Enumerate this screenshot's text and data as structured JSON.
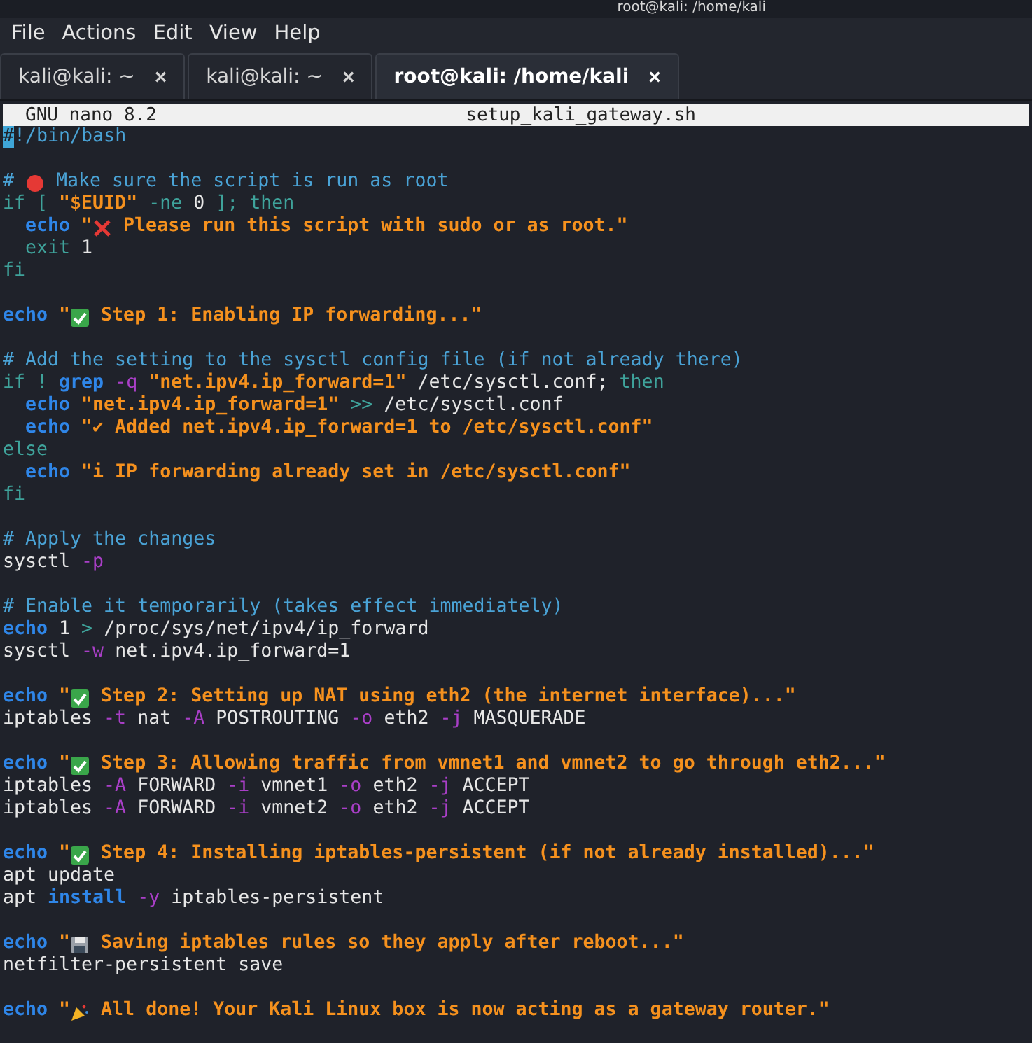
{
  "window": {
    "title": "root@kali: /home/kali"
  },
  "menu": [
    "File",
    "Actions",
    "Edit",
    "View",
    "Help"
  ],
  "tabs": [
    {
      "label": "kali@kali: ~",
      "close": "×",
      "selected": false
    },
    {
      "label": "kali@kali: ~",
      "close": "×",
      "selected": false
    },
    {
      "label": "root@kali: /home/kali",
      "close": "×",
      "selected": true
    }
  ],
  "nano_header": {
    "version": "GNU nano 8.2",
    "filename": "setup_kali_gateway.sh"
  },
  "lines": [
    {
      "tokens": [
        {
          "kind": "cursor",
          "t": "#"
        },
        {
          "kind": "comment",
          "t": "!/bin/bash"
        }
      ]
    },
    {
      "blank_before": true,
      "tokens": [
        {
          "kind": "comment",
          "t": "#"
        },
        {
          "kind": "dot"
        },
        {
          "kind": "comment",
          "t": "Make sure the script is run as root"
        }
      ]
    },
    {
      "tokens": [
        {
          "kind": "keyword",
          "t": "if ["
        },
        {
          "kind": "string",
          "t": "\"$EUID\""
        },
        {
          "kind": "keyword",
          "t": "-ne"
        },
        {
          "kind": "plain",
          "t": "0"
        },
        {
          "kind": "keyword",
          "t": "]; then"
        }
      ]
    },
    {
      "indented": true,
      "tokens": [
        {
          "kind": "builtin",
          "t": "echo"
        },
        {
          "kind": "string",
          "t": "\""
        },
        {
          "kind": "cross"
        },
        {
          "kind": "string",
          "t": "Please run this script with sudo or as root.\""
        }
      ]
    },
    {
      "indented": true,
      "tokens": [
        {
          "kind": "keyword",
          "t": "exit"
        },
        {
          "kind": "plain",
          "t": "1"
        }
      ]
    },
    {
      "tokens": [
        {
          "kind": "keyword",
          "t": "fi"
        }
      ]
    },
    {
      "blank_before": true,
      "tokens": [
        {
          "kind": "builtin",
          "t": "echo"
        },
        {
          "kind": "string",
          "t": "\""
        },
        {
          "kind": "check"
        },
        {
          "kind": "string",
          "t": "Step 1: Enabling IP forwarding...\""
        }
      ]
    },
    {
      "blank_before": true,
      "tokens": [
        {
          "kind": "comment",
          "t": "# Add the setting to the sysctl config file (if not already there)"
        }
      ]
    },
    {
      "tokens": [
        {
          "kind": "keyword",
          "t": "if !"
        },
        {
          "kind": "builtin",
          "t": "grep"
        },
        {
          "kind": "option",
          "t": "-q"
        },
        {
          "kind": "string",
          "t": "\"net.ipv4.ip_forward=1\""
        },
        {
          "kind": "plain",
          "t": "/etc/sysctl.conf;"
        },
        {
          "kind": "keyword",
          "t": "then"
        }
      ]
    },
    {
      "indented": true,
      "tokens": [
        {
          "kind": "builtin",
          "t": "echo"
        },
        {
          "kind": "string",
          "t": "\"net.ipv4.ip_forward=1\""
        },
        {
          "kind": "keyword",
          "t": ">>"
        },
        {
          "kind": "plain",
          "t": "/etc/sysctl.conf"
        }
      ]
    },
    {
      "indented": true,
      "tokens": [
        {
          "kind": "builtin",
          "t": "echo"
        },
        {
          "kind": "string",
          "t": "\"✔ Added net.ipv4.ip_forward=1 to /etc/sysctl.conf\""
        }
      ]
    },
    {
      "tokens": [
        {
          "kind": "keyword",
          "t": "else"
        }
      ]
    },
    {
      "indented": true,
      "tokens": [
        {
          "kind": "builtin",
          "t": "echo"
        },
        {
          "kind": "string",
          "t": "\"i IP forwarding already set in /etc/sysctl.conf\""
        }
      ]
    },
    {
      "tokens": [
        {
          "kind": "keyword",
          "t": "fi"
        }
      ]
    },
    {
      "blank_before": true,
      "tokens": [
        {
          "kind": "comment",
          "t": "# Apply the changes"
        }
      ]
    },
    {
      "tokens": [
        {
          "kind": "plain",
          "t": "sysctl"
        },
        {
          "kind": "option",
          "t": "-p"
        }
      ]
    },
    {
      "blank_before": true,
      "tokens": [
        {
          "kind": "comment",
          "t": "# Enable it temporarily (takes effect immediately)"
        }
      ]
    },
    {
      "tokens": [
        {
          "kind": "builtin",
          "t": "echo"
        },
        {
          "kind": "plain",
          "t": "1"
        },
        {
          "kind": "keyword",
          "t": ">"
        },
        {
          "kind": "plain",
          "t": "/proc/sys/net/ipv4/ip_forward"
        }
      ]
    },
    {
      "tokens": [
        {
          "kind": "plain",
          "t": "sysctl"
        },
        {
          "kind": "option",
          "t": "-w"
        },
        {
          "kind": "plain",
          "t": "net.ipv4.ip_forward=1"
        }
      ]
    },
    {
      "blank_before": true,
      "tokens": [
        {
          "kind": "builtin",
          "t": "echo"
        },
        {
          "kind": "string",
          "t": "\""
        },
        {
          "kind": "check"
        },
        {
          "kind": "string",
          "t": "Step 2: Setting up NAT using eth2 (the internet interface)...\""
        }
      ]
    },
    {
      "tokens": [
        {
          "kind": "plain",
          "t": "iptables"
        },
        {
          "kind": "option",
          "t": "-t"
        },
        {
          "kind": "plain",
          "t": "nat"
        },
        {
          "kind": "option",
          "t": "-A"
        },
        {
          "kind": "plain",
          "t": "POSTROUTING"
        },
        {
          "kind": "option",
          "t": "-o"
        },
        {
          "kind": "plain",
          "t": "eth2"
        },
        {
          "kind": "option",
          "t": "-j"
        },
        {
          "kind": "plain",
          "t": "MASQUERADE"
        }
      ]
    },
    {
      "blank_before": true,
      "tokens": [
        {
          "kind": "builtin",
          "t": "echo"
        },
        {
          "kind": "string",
          "t": "\""
        },
        {
          "kind": "check"
        },
        {
          "kind": "string",
          "t": "Step 3: Allowing traffic from vmnet1 and vmnet2 to go through eth2...\""
        }
      ]
    },
    {
      "tokens": [
        {
          "kind": "plain",
          "t": "iptables"
        },
        {
          "kind": "option",
          "t": "-A"
        },
        {
          "kind": "plain",
          "t": "FORWARD"
        },
        {
          "kind": "option",
          "t": "-i"
        },
        {
          "kind": "plain",
          "t": "vmnet1"
        },
        {
          "kind": "option",
          "t": "-o"
        },
        {
          "kind": "plain",
          "t": "eth2"
        },
        {
          "kind": "option",
          "t": "-j"
        },
        {
          "kind": "plain",
          "t": "ACCEPT"
        }
      ]
    },
    {
      "tokens": [
        {
          "kind": "plain",
          "t": "iptables"
        },
        {
          "kind": "option",
          "t": "-A"
        },
        {
          "kind": "plain",
          "t": "FORWARD"
        },
        {
          "kind": "option",
          "t": "-i"
        },
        {
          "kind": "plain",
          "t": "vmnet2"
        },
        {
          "kind": "option",
          "t": "-o"
        },
        {
          "kind": "plain",
          "t": "eth2"
        },
        {
          "kind": "option",
          "t": "-j"
        },
        {
          "kind": "plain",
          "t": "ACCEPT"
        }
      ]
    },
    {
      "blank_before": true,
      "tokens": [
        {
          "kind": "builtin",
          "t": "echo"
        },
        {
          "kind": "string",
          "t": "\""
        },
        {
          "kind": "check"
        },
        {
          "kind": "string",
          "t": "Step 4: Installing iptables-persistent (if not already installed)...\""
        }
      ]
    },
    {
      "tokens": [
        {
          "kind": "plain",
          "t": "apt update"
        }
      ]
    },
    {
      "tokens": [
        {
          "kind": "plain",
          "t": "apt"
        },
        {
          "kind": "builtin",
          "t": "install"
        },
        {
          "kind": "option",
          "t": "-y"
        },
        {
          "kind": "plain",
          "t": "iptables-persistent"
        }
      ]
    },
    {
      "blank_before": true,
      "tokens": [
        {
          "kind": "builtin",
          "t": "echo"
        },
        {
          "kind": "string",
          "t": "\""
        },
        {
          "kind": "disk"
        },
        {
          "kind": "string",
          "t": "Saving iptables rules so they apply after reboot...\""
        }
      ]
    },
    {
      "tokens": [
        {
          "kind": "plain",
          "t": "netfilter-persistent save"
        }
      ]
    },
    {
      "blank_before": true,
      "tokens": [
        {
          "kind": "builtin",
          "t": "echo"
        },
        {
          "kind": "string",
          "t": "\""
        },
        {
          "kind": "party"
        },
        {
          "kind": "string",
          "t": "All done! Your Kali Linux box is now acting as a gateway router.\""
        }
      ]
    }
  ]
}
